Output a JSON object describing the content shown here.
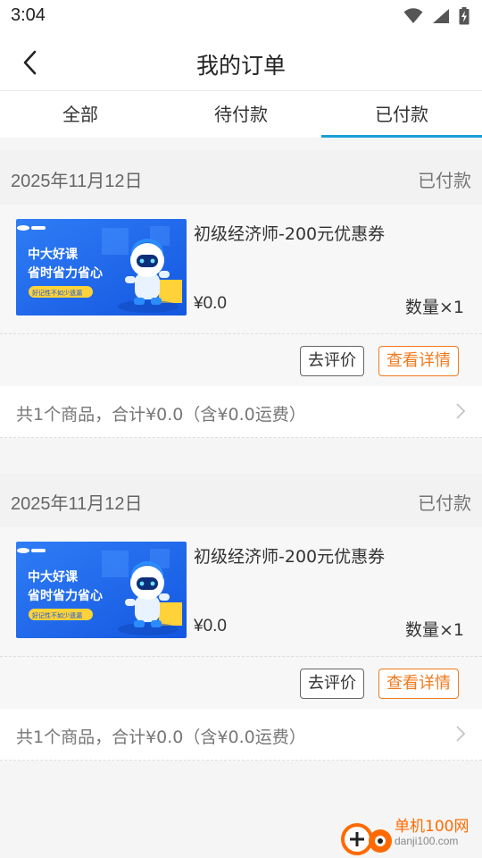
{
  "status_bar": {
    "time": "3:04",
    "icons": [
      "wifi-icon",
      "signal-icon",
      "battery-charging-icon"
    ]
  },
  "nav": {
    "title": "我的订单",
    "back_icon": "chevron-left-icon"
  },
  "tabs": [
    {
      "label": "全部",
      "active": false
    },
    {
      "label": "待付款",
      "active": false
    },
    {
      "label": "已付款",
      "active": true
    }
  ],
  "accent_color": "#1aa0d8",
  "button_accent_color": "#f07a1e",
  "orders": [
    {
      "date": "2025年11月12日",
      "status": "已付款",
      "item": {
        "name": "初级经济师-200元优惠券",
        "price": "¥0.0",
        "quantity": "数量×1",
        "banner_line1": "中大好课",
        "banner_line2": "省时省力省心",
        "banner_tag": "好记性不如少遗漏"
      },
      "review_label": "去评价",
      "detail_label": "查看详情",
      "summary": "共1个商品，合计¥0.0（含¥0.0运费）"
    },
    {
      "date": "2025年11月12日",
      "status": "已付款",
      "item": {
        "name": "初级经济师-200元优惠券",
        "price": "¥0.0",
        "quantity": "数量×1",
        "banner_line1": "中大好课",
        "banner_line2": "省时省力省心",
        "banner_tag": "好记性不如少遗漏"
      },
      "review_label": "去评价",
      "detail_label": "查看详情",
      "summary": "共1个商品，合计¥0.0（含¥0.0运费）"
    }
  ],
  "watermark": {
    "cn": "单机100网",
    "en": "danji100.com"
  }
}
